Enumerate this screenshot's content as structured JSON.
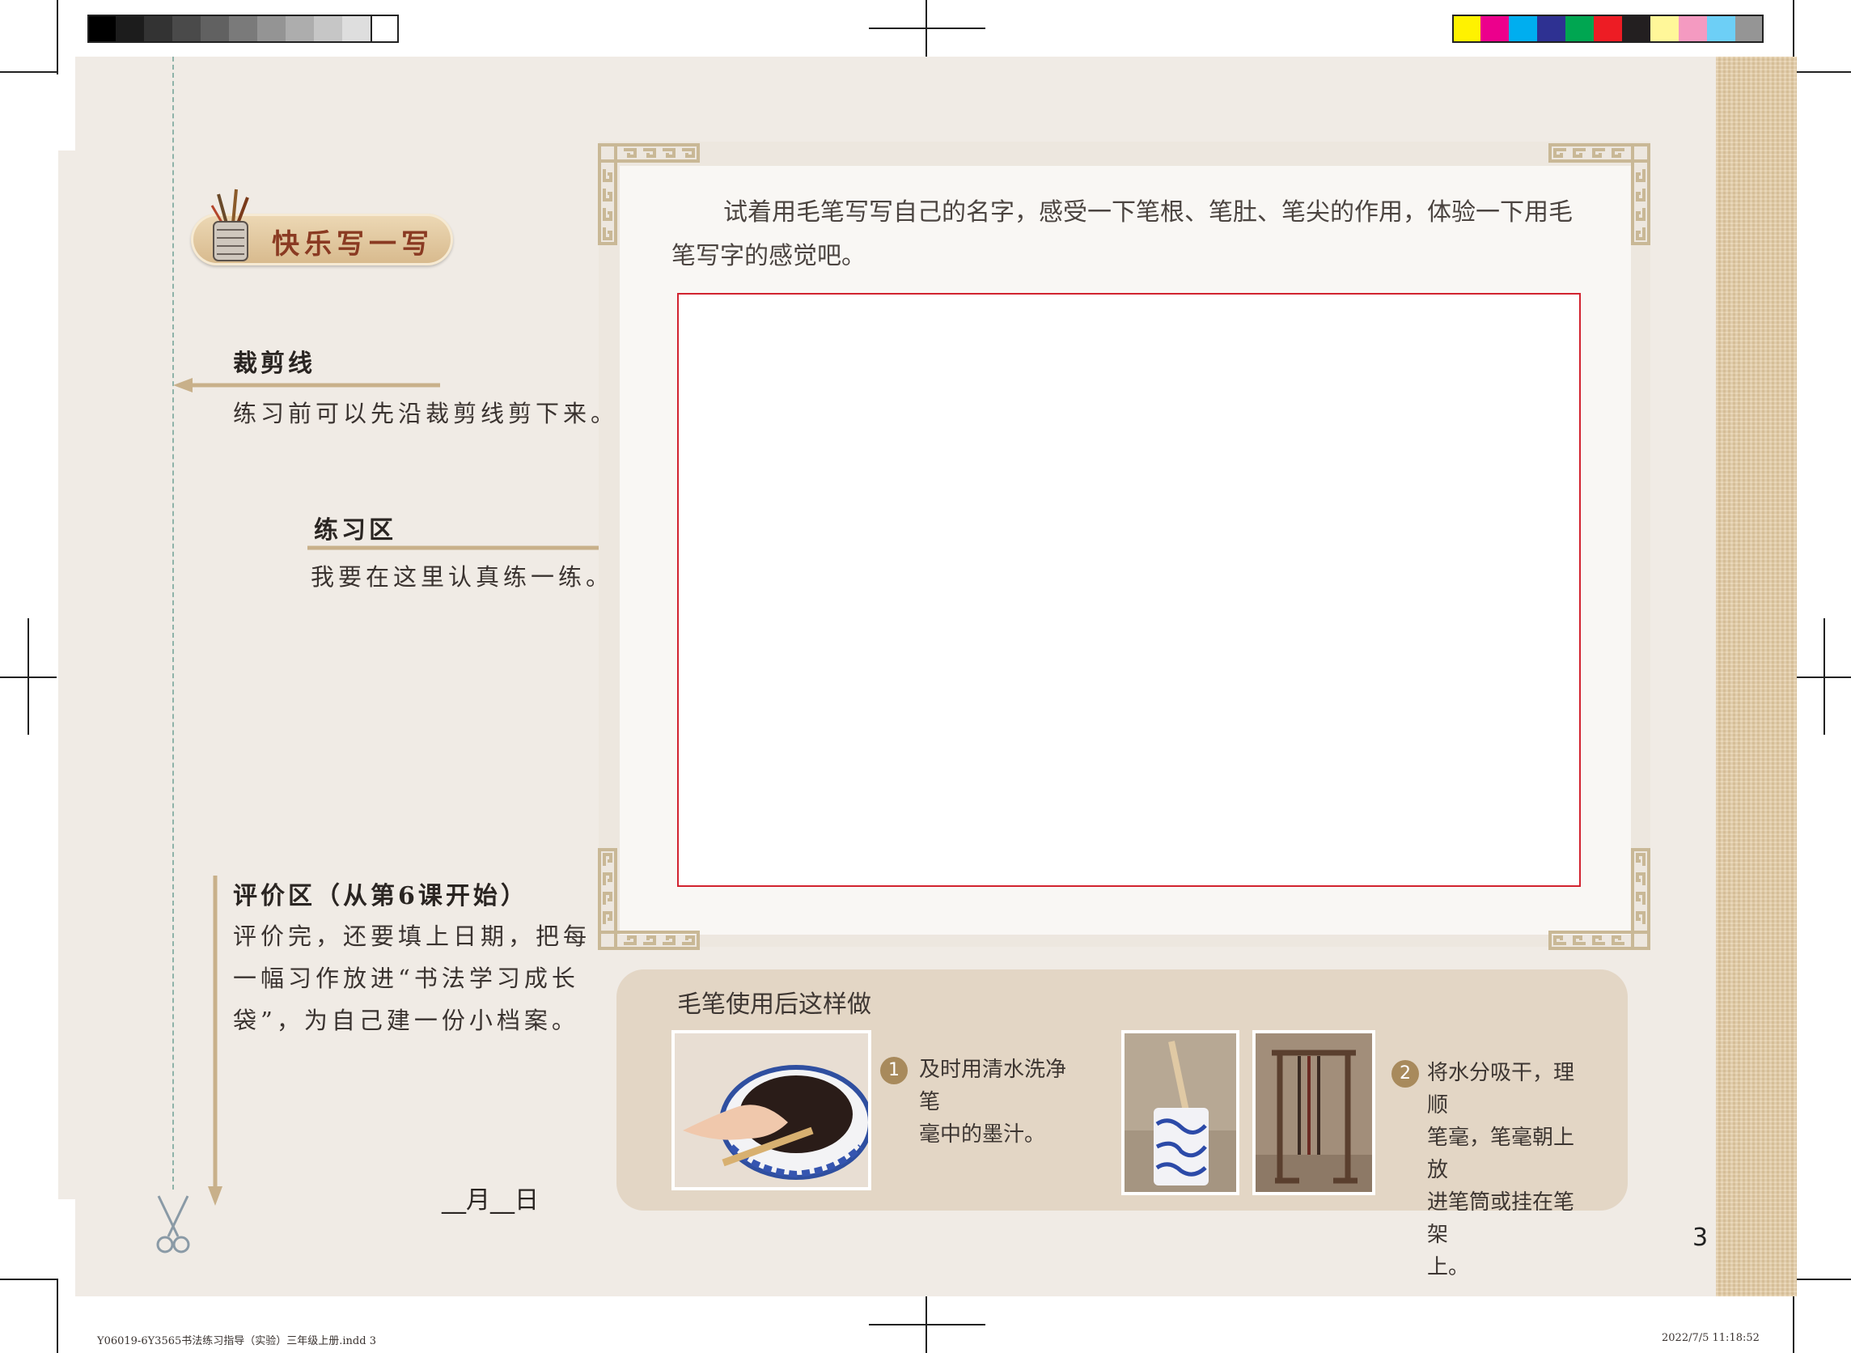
{
  "header_badge": {
    "label": "快乐写一写"
  },
  "side_notes": {
    "cut_line": {
      "title": "裁剪线",
      "desc": "练习前可以先沿裁剪线剪下来。"
    },
    "practice_area": {
      "title": "练习区",
      "desc": "我要在这里认真练一练。"
    },
    "evaluation": {
      "title": "评价区（从第6课开始）",
      "lines": [
        "评价完，还要填上日期，把每",
        "一幅习作放进“书法学习成长",
        "袋”，为自己建一份小档案。"
      ],
      "date_label": "__月__日"
    }
  },
  "practice": {
    "instruction_line1": "试着用毛笔写写自己的名字，感受一下笔根、笔肚、笔尖的作用，体验一下用毛",
    "instruction_line2": "笔写字的感觉吧。"
  },
  "brush_care": {
    "title": "毛笔使用后这样做",
    "steps": [
      {
        "num": "1",
        "lines": [
          "及时用清水洗净笔",
          "毫中的墨汁。"
        ]
      },
      {
        "num": "2",
        "lines": [
          "将水分吸干，理顺",
          "笔毫，笔毫朝上放",
          "进笔筒或挂在笔架",
          "上。"
        ]
      }
    ]
  },
  "page_number": "3",
  "footer": {
    "left": "Y06019-6Y3565书法练习指导（实验）三年级上册.indd   3",
    "right": "2022/7/5   11:18:52"
  },
  "colors": {
    "page_bg": "#f0ebe5",
    "accent_tan": "#c8b08a",
    "box_red": "#d2232f",
    "panel": "#e3d6c5"
  }
}
